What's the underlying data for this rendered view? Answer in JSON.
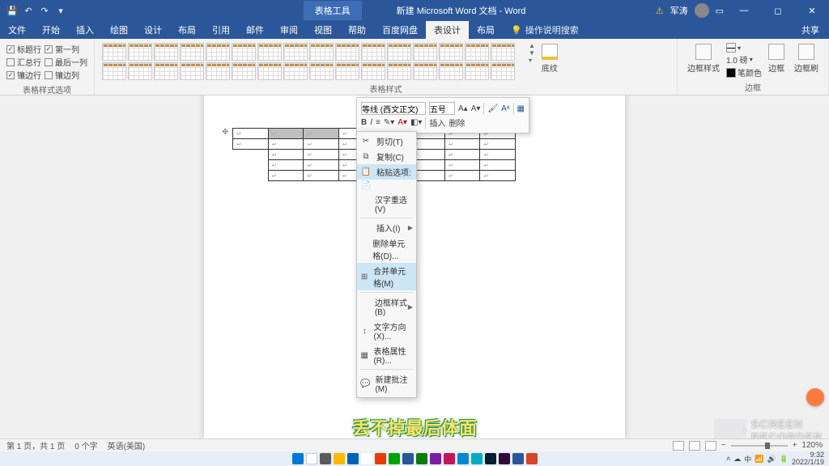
{
  "titlebar": {
    "tab_context": "表格工具",
    "doc_title": "新建 Microsoft Word 文档 - Word",
    "warning": "⚠",
    "username": "军涛",
    "share": "共享"
  },
  "menu": {
    "items": [
      "文件",
      "开始",
      "插入",
      "绘图",
      "设计",
      "布局",
      "引用",
      "邮件",
      "审阅",
      "视图",
      "帮助",
      "百度网盘",
      "表设计",
      "布局"
    ],
    "active_index": 12,
    "tell_me_icon": "💡",
    "tell_me": "操作说明搜索"
  },
  "ribbon": {
    "opts": {
      "header_row": "标题行",
      "first_col": "第一列",
      "total_row": "汇总行",
      "last_col": "最后一列",
      "banded_row": "镶边行",
      "banded_col": "镶边列",
      "group": "表格样式选项"
    },
    "styles_group": "表格样式",
    "shading": "底纹",
    "border_styles": "边框样式",
    "pen_weight": "1.0 磅",
    "pen_color": "笔颜色",
    "borders": "边框",
    "border_painter": "边框刷",
    "borders_group": "边框"
  },
  "minitoolbar": {
    "font": "等线 (西文正文)",
    "size": "五号",
    "insert": "插入",
    "delete": "删除"
  },
  "context_menu": {
    "cut": "剪切(T)",
    "copy": "复制(C)",
    "paste_opts": "粘贴选项:",
    "font_dlg": "汉字重选(V)",
    "insert": "插入(I)",
    "delete_cells": "删除单元格(D)...",
    "merge": "合并单元格(M)",
    "border_styles": "边框样式(B)",
    "text_direction": "文字方向(X)...",
    "table_props": "表格属性(R)...",
    "new_comment": "新建批注(M)"
  },
  "subtitle": "丢不掉最后体面",
  "watermark": {
    "line1": "SCREEN",
    "line2": "RECORDER"
  },
  "status": {
    "page": "第 1 页，共 1 页",
    "words": "0 个字",
    "lang": "英语(美国)",
    "zoom": "120%"
  },
  "tray": {
    "time": "9:32",
    "date": "2022/1/19"
  }
}
